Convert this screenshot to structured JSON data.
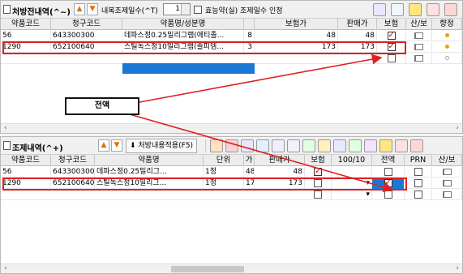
{
  "top": {
    "title": "처방전내역(^~)",
    "adjust_label": "내복조제일수(^T)",
    "adjust_value": "1",
    "honoring_label": "효능약(실) 조제일수 인정",
    "columns": [
      "약품코드",
      "청구코드",
      "약품명/성분명",
      "",
      "보험가",
      "판매가",
      "보험",
      "산/보",
      "향정"
    ],
    "rows": [
      {
        "code": "56",
        "claim": "643300300",
        "name": "데파스정0.25밀리그램(에티졸...",
        "qty": "8",
        "ins_price": "48",
        "sale_price": "48",
        "insurance": true,
        "dot": true
      },
      {
        "code": "1290",
        "claim": "652100640",
        "name": "스틸녹스정10밀리그램(졸피뎀...",
        "qty": "3",
        "ins_price": "173",
        "sale_price": "173",
        "insurance": true,
        "dot": true
      },
      {
        "code": "",
        "claim": "",
        "name": "",
        "qty": "",
        "ins_price": "",
        "sale_price": "",
        "insurance": false,
        "dot": false
      }
    ]
  },
  "bottom": {
    "title": "조제내역(^+)",
    "apply_label": "처방내용적용(F5)",
    "columns": [
      "약품코드",
      "청구코드",
      "약품명",
      "단위",
      "가",
      "판매가",
      "보험",
      "100/10",
      "전액",
      "PRN",
      "산/보"
    ],
    "rows": [
      {
        "code": "56",
        "claim": "643300300",
        "name": "데파스정0.25밀리그...",
        "unit": "1정",
        "a": "48",
        "sale": "48",
        "insurance": true,
        "ratio": "",
        "full": false,
        "prn": false
      },
      {
        "code": "1290",
        "claim": "652100640",
        "name": "스틸녹스정10밀리그...",
        "unit": "1정",
        "a": "173",
        "sale": "173",
        "insurance": false,
        "ratio": "",
        "full": true,
        "prn": false
      },
      {
        "code": "",
        "claim": "",
        "name": "",
        "unit": "",
        "a": "",
        "sale": "",
        "insurance": false,
        "ratio": "",
        "full": false,
        "prn": false
      }
    ]
  },
  "callout": {
    "text": "전액"
  }
}
